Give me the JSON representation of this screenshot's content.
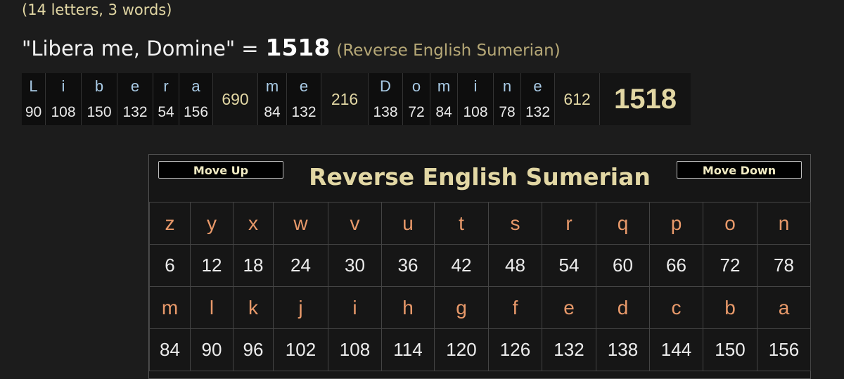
{
  "header": {
    "letter_count": "(14 letters, 3 words)",
    "phrase": "\"Libera me, Domine\"",
    "equals": "=",
    "total": "1518",
    "cipher_label": "(Reverse English Sumerian)"
  },
  "breakdown": {
    "words": [
      {
        "letters": [
          "L",
          "i",
          "b",
          "e",
          "r",
          "a"
        ],
        "values": [
          "90",
          "108",
          "150",
          "132",
          "54",
          "156"
        ],
        "sum": "690"
      },
      {
        "letters": [
          "m",
          "e"
        ],
        "values": [
          "84",
          "132"
        ],
        "sum": "216"
      },
      {
        "letters": [
          "D",
          "o",
          "m",
          "i",
          "n",
          "e"
        ],
        "values": [
          "138",
          "72",
          "84",
          "108",
          "78",
          "132"
        ],
        "sum": "612"
      }
    ],
    "total": "1518"
  },
  "cipher": {
    "title": "Reverse English Sumerian",
    "move_up_label": "Move Up",
    "move_down_label": "Move Down",
    "rows": [
      {
        "letters": [
          "z",
          "y",
          "x",
          "w",
          "v",
          "u",
          "t",
          "s",
          "r",
          "q",
          "p",
          "o",
          "n"
        ],
        "values": [
          "6",
          "12",
          "18",
          "24",
          "30",
          "36",
          "42",
          "48",
          "54",
          "60",
          "66",
          "72",
          "78"
        ]
      },
      {
        "letters": [
          "m",
          "l",
          "k",
          "j",
          "i",
          "h",
          "g",
          "f",
          "e",
          "d",
          "c",
          "b",
          "a"
        ],
        "values": [
          "84",
          "90",
          "96",
          "102",
          "108",
          "114",
          "120",
          "126",
          "132",
          "138",
          "144",
          "150",
          "156"
        ]
      }
    ]
  },
  "colors": {
    "background": "#1c1c1c",
    "accent_gold": "#e2d7a4",
    "letter_blue": "#a9cbe6",
    "letter_orange": "#e8996a"
  }
}
